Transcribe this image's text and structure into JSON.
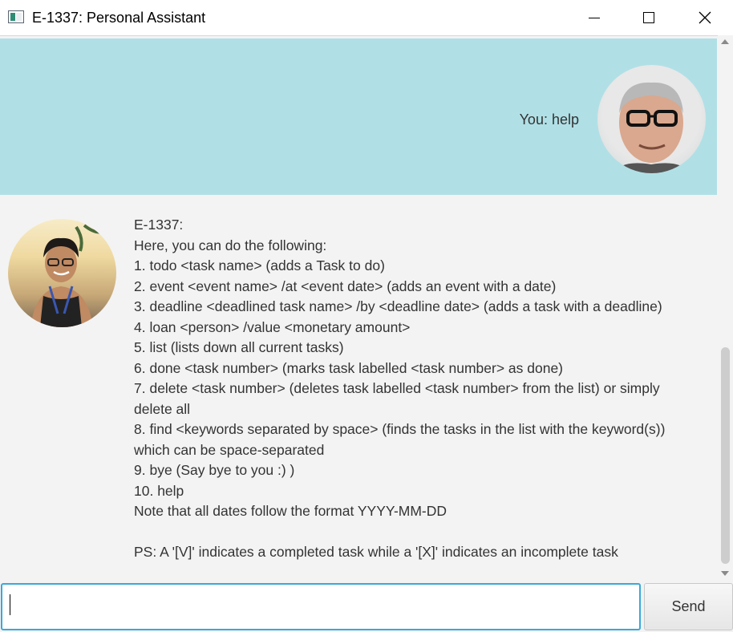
{
  "window": {
    "title": "E-1337: Personal Assistant",
    "controls": {
      "minimize": "minimize-icon",
      "maximize": "maximize-icon",
      "close": "close-icon"
    }
  },
  "chat": {
    "user_message": "You: help",
    "user_avatar": "user-avatar",
    "bot_avatar": "bot-avatar",
    "colors": {
      "user_bubble": "#b0e0e6",
      "chat_bg": "#f3f3f3"
    },
    "bot_lines": [
      "E-1337:",
      "Here, you can do the following:",
      "1. todo <task name> (adds a Task to do)",
      "2. event <event name> /at <event date> (adds an event with a date)",
      "3. deadline <deadlined task name> /by <deadline date> (adds a task with a deadline)",
      "4. loan <person> /value <monetary amount>",
      "5. list (lists down all current tasks)",
      "6. done <task number> (marks task labelled <task number> as done)",
      "7. delete <task number> (deletes task labelled <task number> from the list) or simply",
      "delete all",
      "8. find <keywords separated by space> (finds the tasks in the list with the keyword(s))",
      "which can be space-separated",
      "9. bye (Say bye to you :) )",
      "10. help",
      "Note that all dates follow the format YYYY-MM-DD",
      "",
      "PS: A '[V]' indicates a completed task while a '[X]' indicates an incomplete task"
    ]
  },
  "input": {
    "value": "",
    "placeholder": "",
    "accent": "#39a9dc"
  },
  "send_button": {
    "label": "Send"
  }
}
